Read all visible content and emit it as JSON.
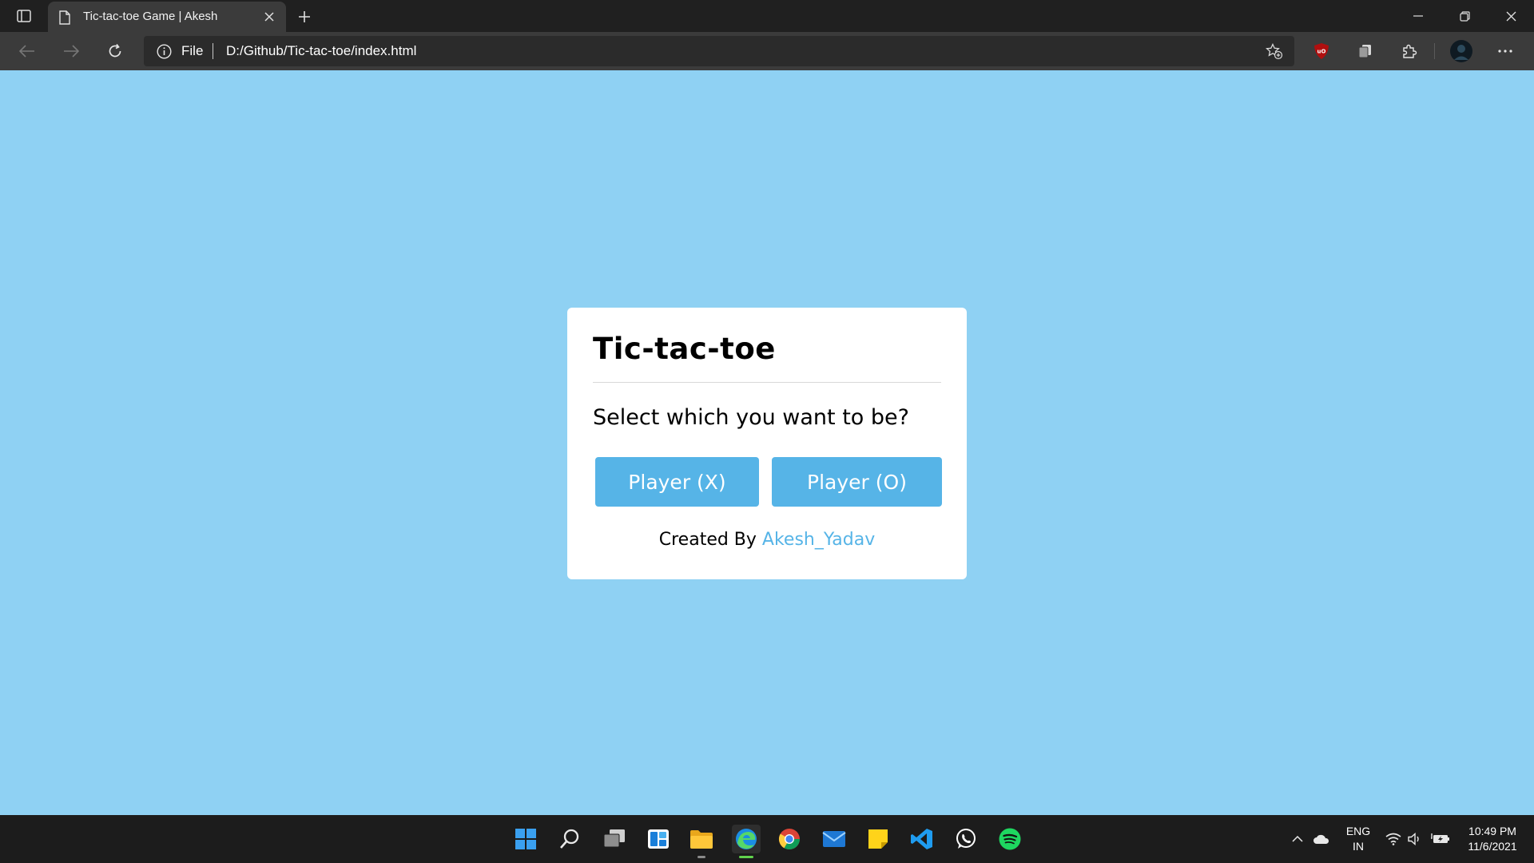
{
  "browser": {
    "tab_title": "Tic-tac-toe Game | Akesh",
    "address": {
      "protocol_label": "File",
      "url": "D:/Github/Tic-tac-toe/index.html"
    }
  },
  "page": {
    "background": "#8fd1f3",
    "card": {
      "title": "Tic-tac-toe",
      "prompt": "Select which you want to be?",
      "button_x": "Player (X)",
      "button_o": "Player (O)",
      "credit_prefix": "Created By ",
      "credit_author": "Akesh_Yadav",
      "accent_color": "#56b4e7"
    }
  },
  "taskbar": {
    "apps": [
      "start-icon",
      "search-icon",
      "task-view-icon",
      "widgets-icon",
      "file-explorer-icon",
      "edge-icon",
      "chrome-icon",
      "mail-icon",
      "sticky-notes-icon",
      "vscode-icon",
      "whatsapp-icon",
      "spotify-icon"
    ],
    "language_line1": "ENG",
    "language_line2": "IN",
    "time": "10:49 PM",
    "date": "11/6/2021"
  }
}
